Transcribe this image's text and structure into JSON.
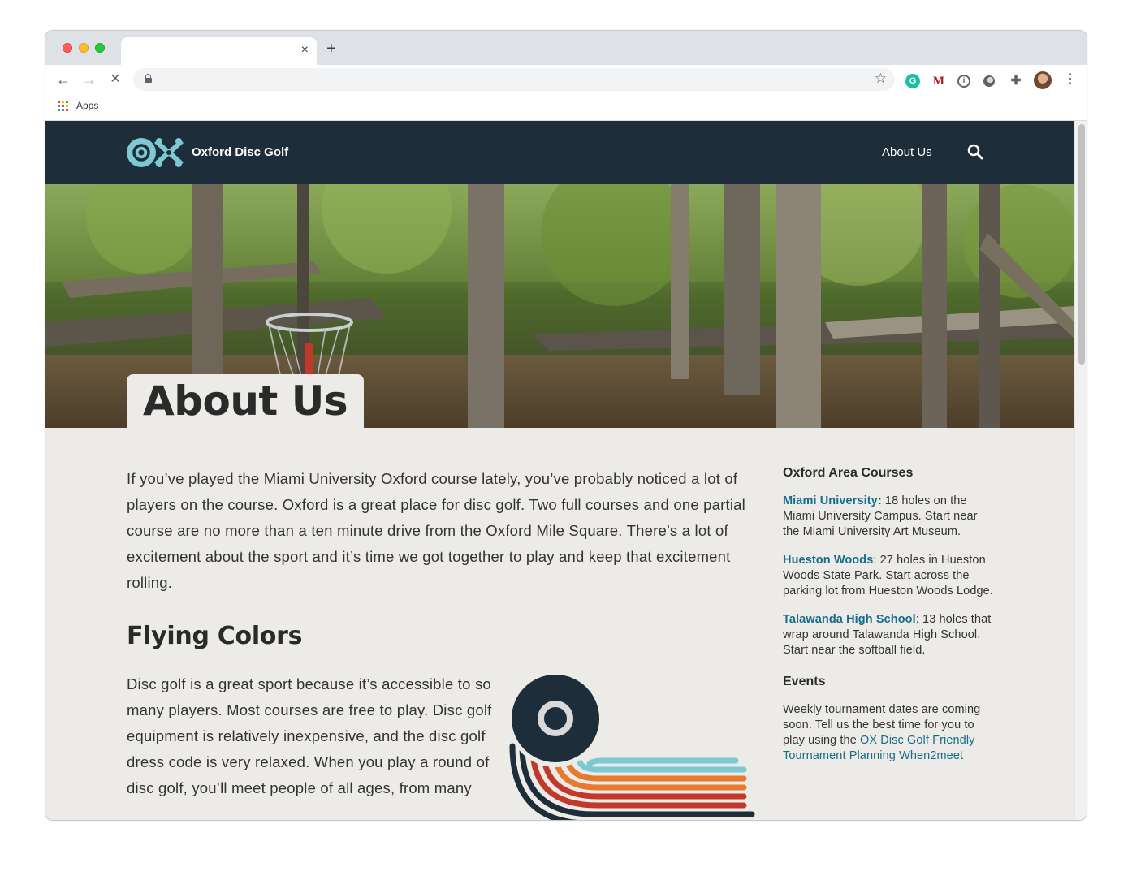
{
  "browser": {
    "tab_title": "",
    "tab_close": "×",
    "new_tab": "+",
    "back": "←",
    "forward": "→",
    "stop": "✕",
    "star": "☆",
    "menu": "⋮",
    "bookmarks": {
      "apps_label": "Apps"
    },
    "extensions": {
      "grammarly": "G",
      "miami": "M",
      "info": "i",
      "puzzle": "✚"
    }
  },
  "site": {
    "name": "Oxford Disc Golf",
    "nav": {
      "about_label": "About Us"
    },
    "page_title": "About Us",
    "intro": "If you’ve played the Miami University Oxford course lately, you’ve probably noticed a lot of players on the course. Oxford is a great place for disc golf. Two full courses and one partial course are no more than a ten minute drive from the Oxford Mile Square. There’s a lot of excitement about the sport and it’s time we got together to play and keep that excitement rolling.",
    "section_heading": "Flying Colors",
    "section_text": "Disc golf is a great sport because it’s accessible to so many players. Most courses are free to play. Disc golf equipment is relatively inexpensive, and the disc golf dress code is very relaxed. When you play a round of disc golf, you’ll meet people of all ages, from many"
  },
  "sidebar": {
    "courses_heading": "Oxford Area Courses",
    "courses": [
      {
        "name": "Miami University",
        "sep": ":",
        "text": " 18 holes on the Miami University Campus. Start near the Miami University Art Museum."
      },
      {
        "name": "Hueston Woods",
        "sep": ":",
        "text": " 27 holes in Hueston Woods State Park. Start across the parking lot from Hueston Woods Lodge."
      },
      {
        "name": "Talawanda High School",
        "sep": ":",
        "text": " 13 holes that wrap around Talawanda High School. Start near the softball field."
      }
    ],
    "events_heading": "Events",
    "events_text": "Weekly tournament dates are coming soon. Tell us the best time for you to play using the ",
    "events_link": "OX Disc Golf Friendly Tournament Planning When2meet"
  },
  "colors": {
    "header_bg": "#1d2d3a",
    "page_bg": "#ecebe8",
    "link": "#156c8b",
    "logo_teal": "#7ec8d3",
    "stripe_orange": "#e67a2e",
    "stripe_red": "#c0392b"
  }
}
